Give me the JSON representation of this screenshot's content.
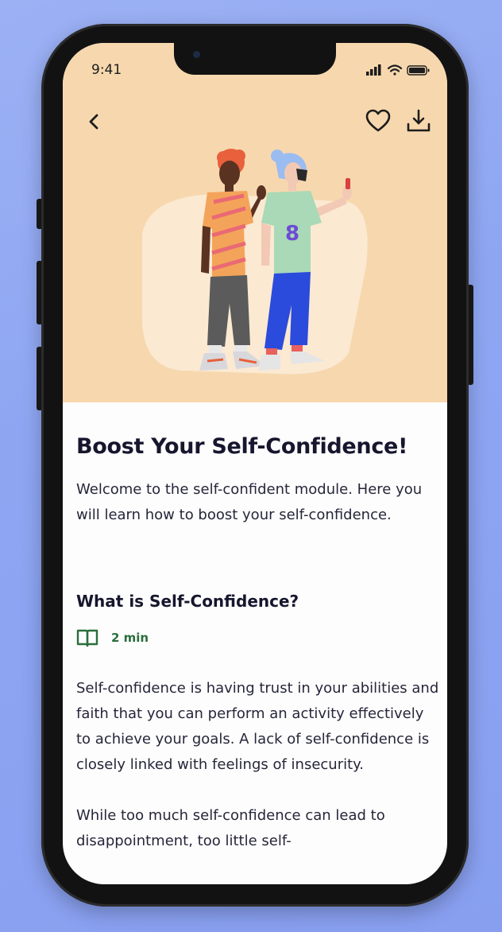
{
  "status_bar": {
    "time": "9:41"
  },
  "header": {
    "back_icon": "chevron-left-icon",
    "favorite_icon": "heart-outline-icon",
    "download_icon": "download-icon",
    "hero_background": "#f7d8ae"
  },
  "module": {
    "title": "Boost Your Self-Confidence!",
    "intro": "Welcome to the self-confident module. Here you will learn how to boost your self-confidence."
  },
  "section": {
    "title": "What is Self-Confidence?",
    "read_icon": "open-book-icon",
    "read_time": "2 min",
    "accent": "#2b6e3b",
    "paragraphs": [
      "Self-confidence is having trust in your abilities and faith that you can perform an activity effectively to achieve your goals. A lack of self-confidence is closely linked with feelings of insecurity.",
      "While too much self-confidence can lead to disappointment, too little self-"
    ]
  }
}
